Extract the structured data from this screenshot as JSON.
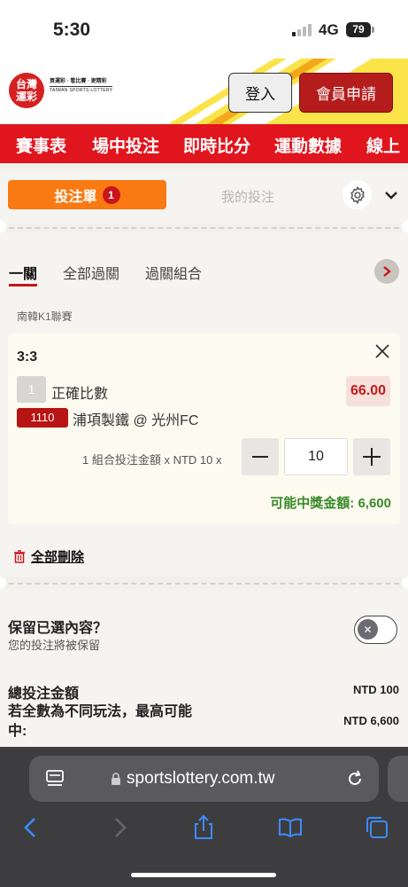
{
  "status_bar": {
    "time": "5:30",
    "network": "4G",
    "battery": "79"
  },
  "header": {
    "logo_line1": "台灣",
    "logo_line2": "運彩",
    "logo_tagline": "買運彩 · 看比賽 · 更精彩",
    "logo_english": "TAIWAN SPORTS LOTTERY",
    "login_label": "登入",
    "signup_label": "會員申請"
  },
  "nav": {
    "items": [
      "賽事表",
      "場中投注",
      "即時比分",
      "運動數據",
      "線上"
    ]
  },
  "betslip": {
    "tab_bet": "投注單",
    "tab_bet_count": "1",
    "tab_mybets": "我的投注",
    "subtabs": [
      "一關",
      "全部過關",
      "過關組合"
    ],
    "league": "南韓K1聯賽",
    "selection": {
      "score": "3:3",
      "num": "1",
      "market": "正確比數",
      "odds": "66.00",
      "match_id": "1110",
      "match_name": "浦項製鐵 @ 光州FC",
      "combo_text": "1 組合投注金額 x NTD 10 x",
      "quantity": "10",
      "payout_text": "可能中獎金額: 6,600"
    },
    "delete_all": "全部刪除",
    "keep_title": "保留已選內容？",
    "keep_sub": "您的投注將被保留",
    "total_label": "總投注金額",
    "total_amount": "NTD 100",
    "max_label": "若全數為不同玩法，最高可能中:",
    "max_amount": "NTD 6,600"
  },
  "browser": {
    "url": "sportslottery.com.tw"
  },
  "colors": {
    "brand_red": "#e0151d",
    "accent_orange": "#f97a12",
    "payout_green": "#3a8a2a"
  }
}
